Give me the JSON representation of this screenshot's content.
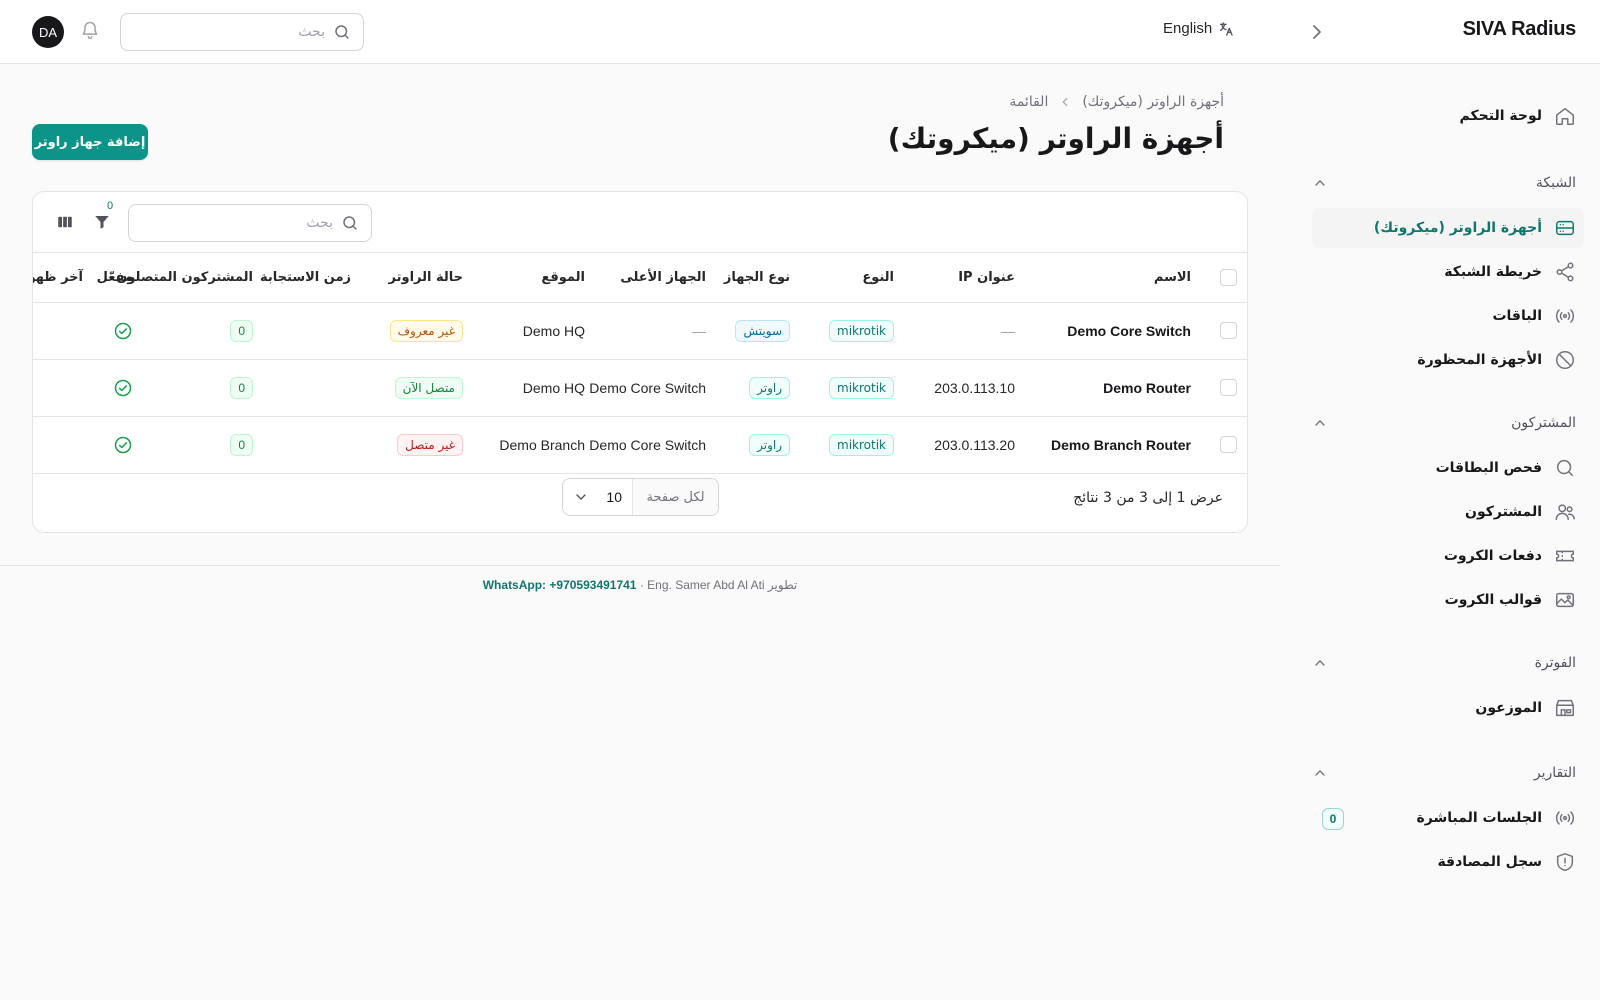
{
  "app": {
    "brand": "SIVA Radius"
  },
  "topbar": {
    "language": "English",
    "search_placeholder": "بحث",
    "avatar_initials": "DA"
  },
  "sidebar": {
    "dashboard": "لوحة التحكم",
    "groups": [
      {
        "label": "الشبكة",
        "items": [
          {
            "label": "أجهزة الراوتر (ميكروتك)",
            "icon": "router-icon",
            "active": true
          },
          {
            "label": "خريطة الشبكة",
            "icon": "share-icon"
          },
          {
            "label": "الباقات",
            "icon": "broadcast-icon"
          },
          {
            "label": "الأجهزة المحظورة",
            "icon": "ban-icon"
          }
        ]
      },
      {
        "label": "المشتركون",
        "items": [
          {
            "label": "فحص البطاقات",
            "icon": "search-icon"
          },
          {
            "label": "المشتركون",
            "icon": "users-icon"
          },
          {
            "label": "دفعات الكروت",
            "icon": "ticket-icon"
          },
          {
            "label": "قوالب الكروت",
            "icon": "image-icon"
          }
        ]
      },
      {
        "label": "الفوترة",
        "items": [
          {
            "label": "الموزعون",
            "icon": "store-icon"
          }
        ]
      },
      {
        "label": "التقارير",
        "items": [
          {
            "label": "الجلسات المباشرة",
            "icon": "broadcast-icon",
            "badge": "0"
          },
          {
            "label": "سجل المصادقة",
            "icon": "shield-icon"
          }
        ]
      }
    ]
  },
  "page": {
    "breadcrumb": [
      "أجهزة الراوتر (ميكروتك)",
      "القائمة"
    ],
    "title": "أجهزة الراوتر (ميكروتك)",
    "add_button": "إضافة جهاز راوتر"
  },
  "table": {
    "search_placeholder": "بحث",
    "filter_count": "0",
    "columns": [
      "الاسم",
      "عنوان IP",
      "النوع",
      "نوع الجهاز",
      "الجهاز الأعلى",
      "الموقع",
      "حالة الراوتر",
      "زمن الاستجابة",
      "المشتركون المتصلون",
      "مفعّل",
      "آخر ظهور"
    ],
    "rows": [
      {
        "name": "Demo Core Switch",
        "ip": "—",
        "type": "mikrotik",
        "device_type": "سويتش",
        "parent": "—",
        "location": "Demo HQ",
        "status": "غير معروف",
        "status_color": "#b45309",
        "latency": "",
        "connected": "0",
        "enabled": true,
        "last_seen": ""
      },
      {
        "name": "Demo Router",
        "ip": "203.0.113.10",
        "type": "mikrotik",
        "device_type": "راوتر",
        "parent": "Demo Core Switch",
        "location": "Demo HQ",
        "status": "متصل الآن",
        "status_color": "#15803d",
        "latency": "",
        "connected": "0",
        "enabled": true,
        "last_seen": ""
      },
      {
        "name": "Demo Branch Router",
        "ip": "203.0.113.20",
        "type": "mikrotik",
        "device_type": "راوتر",
        "parent": "Demo Core Switch",
        "location": "Demo Branch",
        "status": "غير متصل",
        "status_color": "#b91c1c",
        "latency": "",
        "connected": "0",
        "enabled": true,
        "last_seen": ""
      }
    ],
    "pagination": {
      "info": "عرض 1 إلى 3 من 3 نتائج",
      "per_page_label": "لكل صفحة",
      "per_page_value": "10"
    }
  },
  "footer": {
    "credit": "تطوير Eng. Samer Abd Al Ati · ",
    "whatsapp": "WhatsApp: +970593491741"
  },
  "colors": {
    "accent": "#0d9488",
    "accent_text": "#0f766e"
  }
}
